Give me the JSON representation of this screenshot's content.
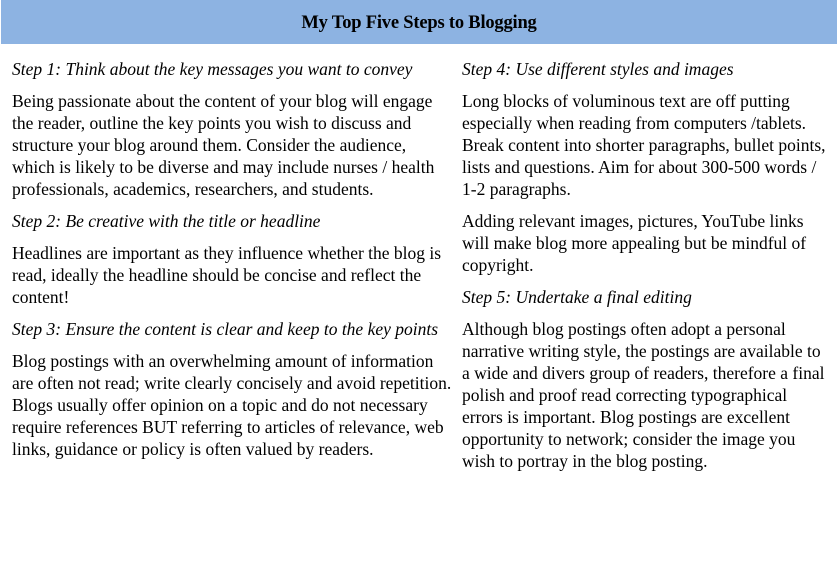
{
  "header": {
    "title": "My Top Five Steps to Blogging",
    "background_color": "#8db3e2"
  },
  "columns": {
    "left": {
      "steps": [
        {
          "heading": "Step 1: Think about the key messages you want to convey",
          "paragraphs": [
            "Being passionate about the content of your blog will engage the reader, outline the key points you wish to discuss and structure your blog around them. Consider the audience, which is likely to be diverse and may include nurses / health professionals, academics, researchers, and students."
          ]
        },
        {
          "heading": "Step 2: Be creative with the title or headline",
          "paragraphs": [
            "Headlines are important as they influence whether the blog is read, ideally the headline should be concise and reflect the content!"
          ]
        },
        {
          "heading": "Step 3: Ensure the content is clear and keep to the key points",
          "paragraphs": [
            "Blog postings with an overwhelming amount of information are often not read; write clearly concisely and avoid repetition. Blogs usually offer opinion on a topic and do not necessary require references BUT referring to articles of relevance, web links, guidance or policy is often valued by readers."
          ]
        }
      ]
    },
    "right": {
      "steps": [
        {
          "heading": "Step 4: Use different styles and images",
          "paragraphs": [
            "Long blocks of voluminous text are off putting especially when reading from computers /tablets. Break content into shorter paragraphs, bullet points, lists and questions. Aim for about 300-500 words / 1-2 paragraphs.",
            "Adding relevant images, pictures, YouTube links will make blog more appealing but be mindful of copyright."
          ]
        },
        {
          "heading": "Step 5: Undertake a final editing",
          "paragraphs": [
            "Although blog postings often adopt a personal narrative writing style, the postings are available to a wide and divers group of readers, therefore a final polish and proof read correcting typographical errors is important. Blog postings are excellent opportunity to network; consider the image you wish to portray in the blog posting."
          ]
        }
      ]
    }
  }
}
